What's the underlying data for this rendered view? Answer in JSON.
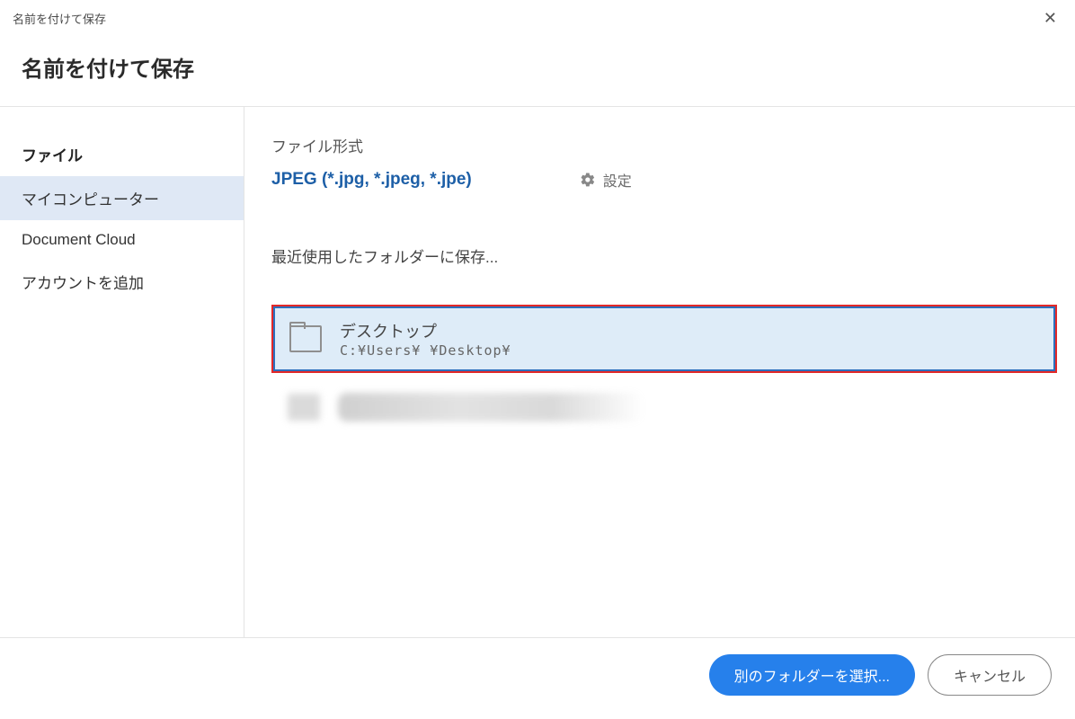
{
  "titlebar": {
    "title": "名前を付けて保存"
  },
  "header": {
    "title": "名前を付けて保存"
  },
  "sidebar": {
    "section_label": "ファイル",
    "items": [
      {
        "label": "マイコンピューター",
        "selected": true
      },
      {
        "label": "Document Cloud",
        "selected": false
      },
      {
        "label": "アカウントを追加",
        "selected": false
      }
    ]
  },
  "main": {
    "format_label": "ファイル形式",
    "format_value": "JPEG (*.jpg, *.jpeg, *.jpe)",
    "settings_label": "設定",
    "recent_label": "最近使用したフォルダーに保存...",
    "folder": {
      "name": "デスクトップ",
      "path": "C:¥Users¥     ¥Desktop¥"
    }
  },
  "footer": {
    "choose_folder": "別のフォルダーを選択...",
    "cancel": "キャンセル"
  }
}
